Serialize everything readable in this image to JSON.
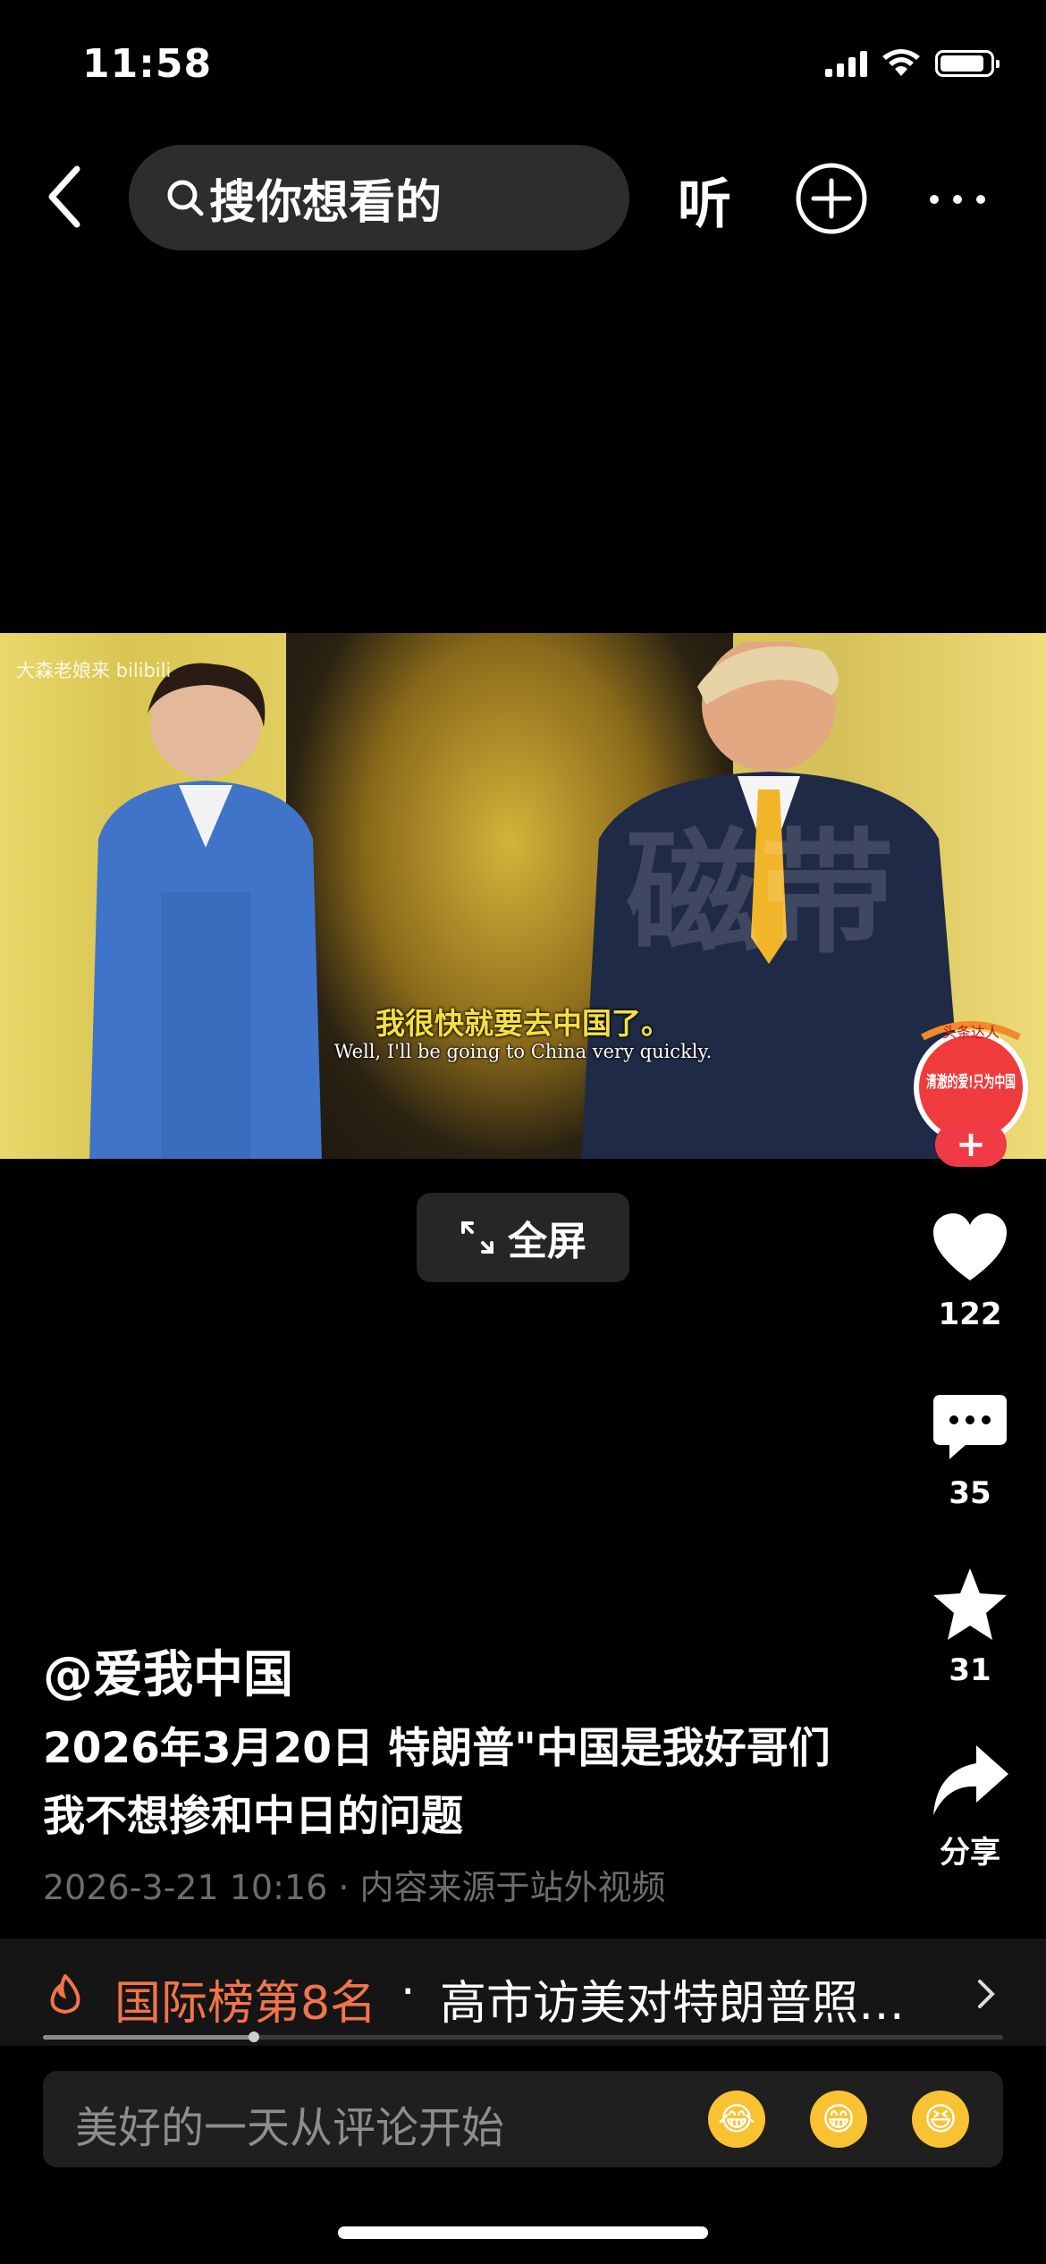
{
  "status_bar": {
    "time": "11:58"
  },
  "nav": {
    "search_placeholder": "搜你想看的",
    "listen_label": "听"
  },
  "video": {
    "watermark": "大森老娘来 bilibili",
    "subtitle_cn": "我很快就要去中国了。",
    "subtitle_en": "Well, I'll be going to China very quickly.",
    "big_watermark": "磁带",
    "fullscreen_label": "全屏"
  },
  "rail": {
    "avatar_badge_top": "头条达人",
    "avatar_text": "清澈的爱!只为中国",
    "like_count": "122",
    "comment_count": "35",
    "favorite_count": "31",
    "share_label": "分享"
  },
  "post": {
    "author": "@爱我中国",
    "title": "2026年3月20日 特朗普\"中国是我好哥们 我不想掺和中日的问题",
    "meta": "2026-3-21 10:16 · 内容来源于站外视频"
  },
  "rank": {
    "rank_label": "国际榜第8名",
    "separator": "·",
    "topic": "高市访美对特朗普照…"
  },
  "playback": {
    "progress": 0.22
  },
  "comment": {
    "placeholder": "美好的一天从评论开始",
    "emojis": [
      "😂",
      "😁",
      "😆"
    ]
  },
  "colors": {
    "accent_orange": "#f2744a",
    "plus_red": "#f03b46",
    "subtitle_yellow": "#f4e041"
  }
}
